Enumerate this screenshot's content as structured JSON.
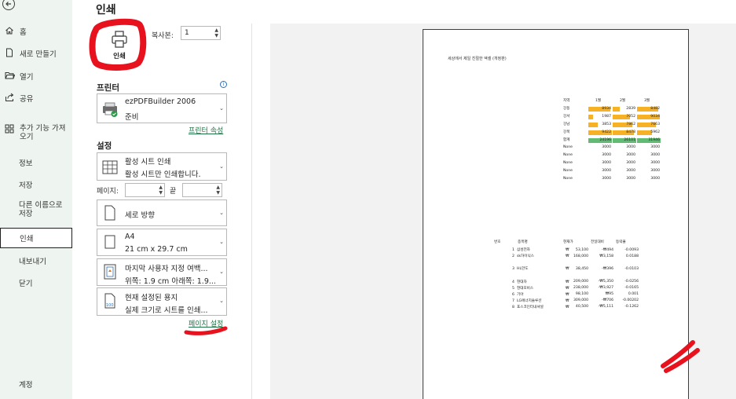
{
  "nav": {
    "home": "홈",
    "new": "새로 만들기",
    "open": "열기",
    "share": "공유",
    "addins": "추가 기능 가져오기",
    "info": "정보",
    "save": "저장",
    "save_as": "다른 이름으로 저장",
    "print": "인쇄",
    "export": "내보내기",
    "close": "닫기",
    "account": "계정"
  },
  "print_panel": {
    "title": "인쇄",
    "print_button": "인쇄",
    "copies_label": "복사본:",
    "copies_value": "1",
    "printer_header": "프린터",
    "printer_name": "ezPDFBuilder 2006",
    "printer_status": "준비",
    "printer_properties": "프린터 속성",
    "settings_header": "설정",
    "scope_title": "활성 시트 인쇄",
    "scope_desc": "활성 시트만 인쇄합니다.",
    "pages_label": "페이지:",
    "to_label": "끝",
    "orientation": "세로 방향",
    "paper_title": "A4",
    "paper_desc": "21 cm x 29.7 cm",
    "margins_title": "마지막 사용자 지정 여백...",
    "margins_desc": "위쪽: 1.9 cm 아래쪽: 1.9...",
    "scaling_title": "현재 설정된 용지",
    "scaling_desc": "실제 크기로 시트를 인쇄...",
    "page_setup": "페이지 설정"
  },
  "icons": [
    "back-arrow-icon",
    "home-icon",
    "new-file-icon",
    "open-folder-icon",
    "share-icon",
    "addins-icon",
    "printer-icon",
    "info-icon",
    "printer-device-icon",
    "sheet-grid-icon",
    "portrait-page-icon",
    "paper-icon",
    "margins-icon",
    "scaling-icon"
  ],
  "colors": {
    "nav_bg": "#eef4ef",
    "accent_green": "#1e7145",
    "bar_orange": "#f7b125",
    "bar_green": "#62bb73",
    "preview_bg": "#f2f2f2",
    "annotation_red": "#e8121e"
  },
  "preview": {
    "sheet_title": "세상에서 제일 친절한 엑셀 (개정판)",
    "table1": {
      "headers": [
        "지역",
        "1월",
        "2월",
        "3월"
      ],
      "rows": [
        [
          "강동",
          "8934",
          "2839",
          "8482"
        ],
        [
          "강서",
          "1987",
          "7052",
          "9034"
        ],
        [
          "강남",
          "3853",
          "7862",
          "7663"
        ],
        [
          "강북",
          "9422",
          "8478",
          "5962"
        ],
        [
          "합계",
          "24196",
          "26101",
          "31946"
        ],
        [
          "None",
          "3000",
          "3000",
          "3000"
        ],
        [
          "None",
          "3000",
          "3000",
          "3000"
        ],
        [
          "None",
          "3000",
          "3000",
          "3000"
        ],
        [
          "None",
          "3000",
          "3000",
          "3000"
        ],
        [
          "None",
          "3000",
          "3000",
          "3000"
        ]
      ]
    },
    "table2": {
      "headers": [
        "번호",
        "종목명",
        "현재가",
        "전일대비",
        "등락율"
      ],
      "rows": [
        [
          "1",
          "삼성전자",
          "₩",
          "53,100",
          "-₩494",
          "-0.0093"
        ],
        [
          "2",
          "sk하이닉스",
          "₩",
          "168,000",
          "₩3,158",
          "0.0188"
        ],
        [
          "3",
          "HL만도",
          "₩",
          "38,450",
          "-₩396",
          "-0.0103"
        ],
        [
          "4",
          "현대차",
          "₩",
          "209,000",
          "-₩5,350",
          "-0.0256"
        ],
        [
          "5",
          "현대모비스",
          "₩",
          "238,000",
          "-₩3,927",
          "-0.0165"
        ],
        [
          "6",
          "기아",
          "₩",
          "98,100",
          "₩95",
          "0.001"
        ],
        [
          "7",
          "LG에너지솔루션",
          "₩",
          "309,000",
          "-₩706",
          "-0.00202"
        ],
        [
          "8",
          "포스코인터내셔널",
          "₩",
          "40,500",
          "-₩5,111",
          "-0.1262"
        ]
      ]
    }
  }
}
